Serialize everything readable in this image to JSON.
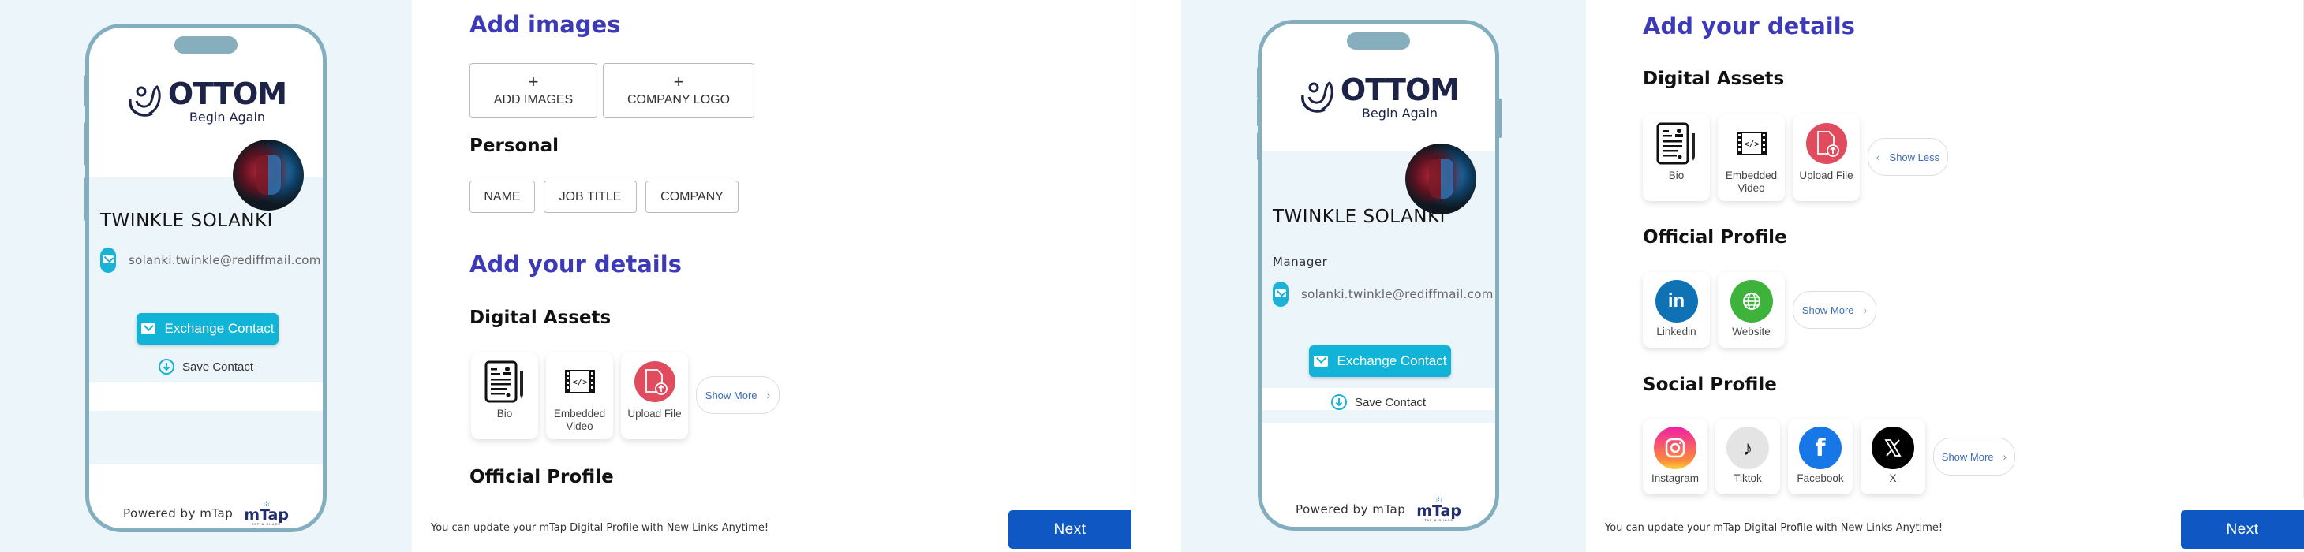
{
  "screens": [
    {
      "preview": {
        "brand": "OTTOM",
        "tagline": "Begin Again",
        "name": "TWINKLE SOLANKI",
        "email": "solanki.twinkle@rediffmail.com",
        "exchange_label": "Exchange Contact",
        "save_label": "Save Contact",
        "powered_by": "Powered by mTap",
        "mtap_word": "mTap",
        "mtap_tag": "TAP & SHARE"
      },
      "form": {
        "images_heading": "Add images",
        "image_buttons": [
          {
            "plus": "+",
            "label": "ADD IMAGES"
          },
          {
            "plus": "+",
            "label": "COMPANY LOGO"
          }
        ],
        "personal_heading": "Personal",
        "personal_chips": [
          "NAME",
          "JOB TITLE",
          "COMPANY"
        ],
        "details_heading": "Add your details",
        "digital_heading": "Digital Assets",
        "digital_items": [
          "Bio",
          "Embedded Video",
          "Upload File"
        ],
        "digital_toggle": "Show More",
        "official_heading": "Official Profile"
      },
      "footer": {
        "note": "You can update your mTap Digital Profile with New Links Anytime!",
        "next_label": "Next"
      }
    },
    {
      "preview": {
        "brand": "OTTOM",
        "tagline": "Begin Again",
        "name": "TWINKLE SOLANKI",
        "job_title": "Manager",
        "email": "solanki.twinkle@rediffmail.com",
        "exchange_label": "Exchange Contact",
        "save_label": "Save Contact",
        "powered_by": "Powered by mTap",
        "mtap_word": "mTap",
        "mtap_tag": "TAP & SHARE"
      },
      "form": {
        "details_heading": "Add your details",
        "digital_heading": "Digital Assets",
        "digital_items": [
          "Bio",
          "Embedded Video",
          "Upload File"
        ],
        "digital_toggle": "Show Less",
        "official_heading": "Official Profile",
        "official_items": [
          "Linkedin",
          "Website"
        ],
        "official_toggle": "Show More",
        "social_heading": "Social Profile",
        "social_items": [
          "Instagram",
          "Tiktok",
          "Facebook",
          "X"
        ],
        "social_toggle": "Show More"
      },
      "footer": {
        "note": "You can update your mTap Digital Profile with New Links Anytime!",
        "next_label": "Next"
      }
    }
  ],
  "colors": {
    "heading_blue": "#3d3ab8",
    "accent_cyan": "#11b3d6",
    "next_blue": "#0f58c4",
    "preview_bg": "#ecf5fa",
    "phone_frame": "#82aebf"
  }
}
